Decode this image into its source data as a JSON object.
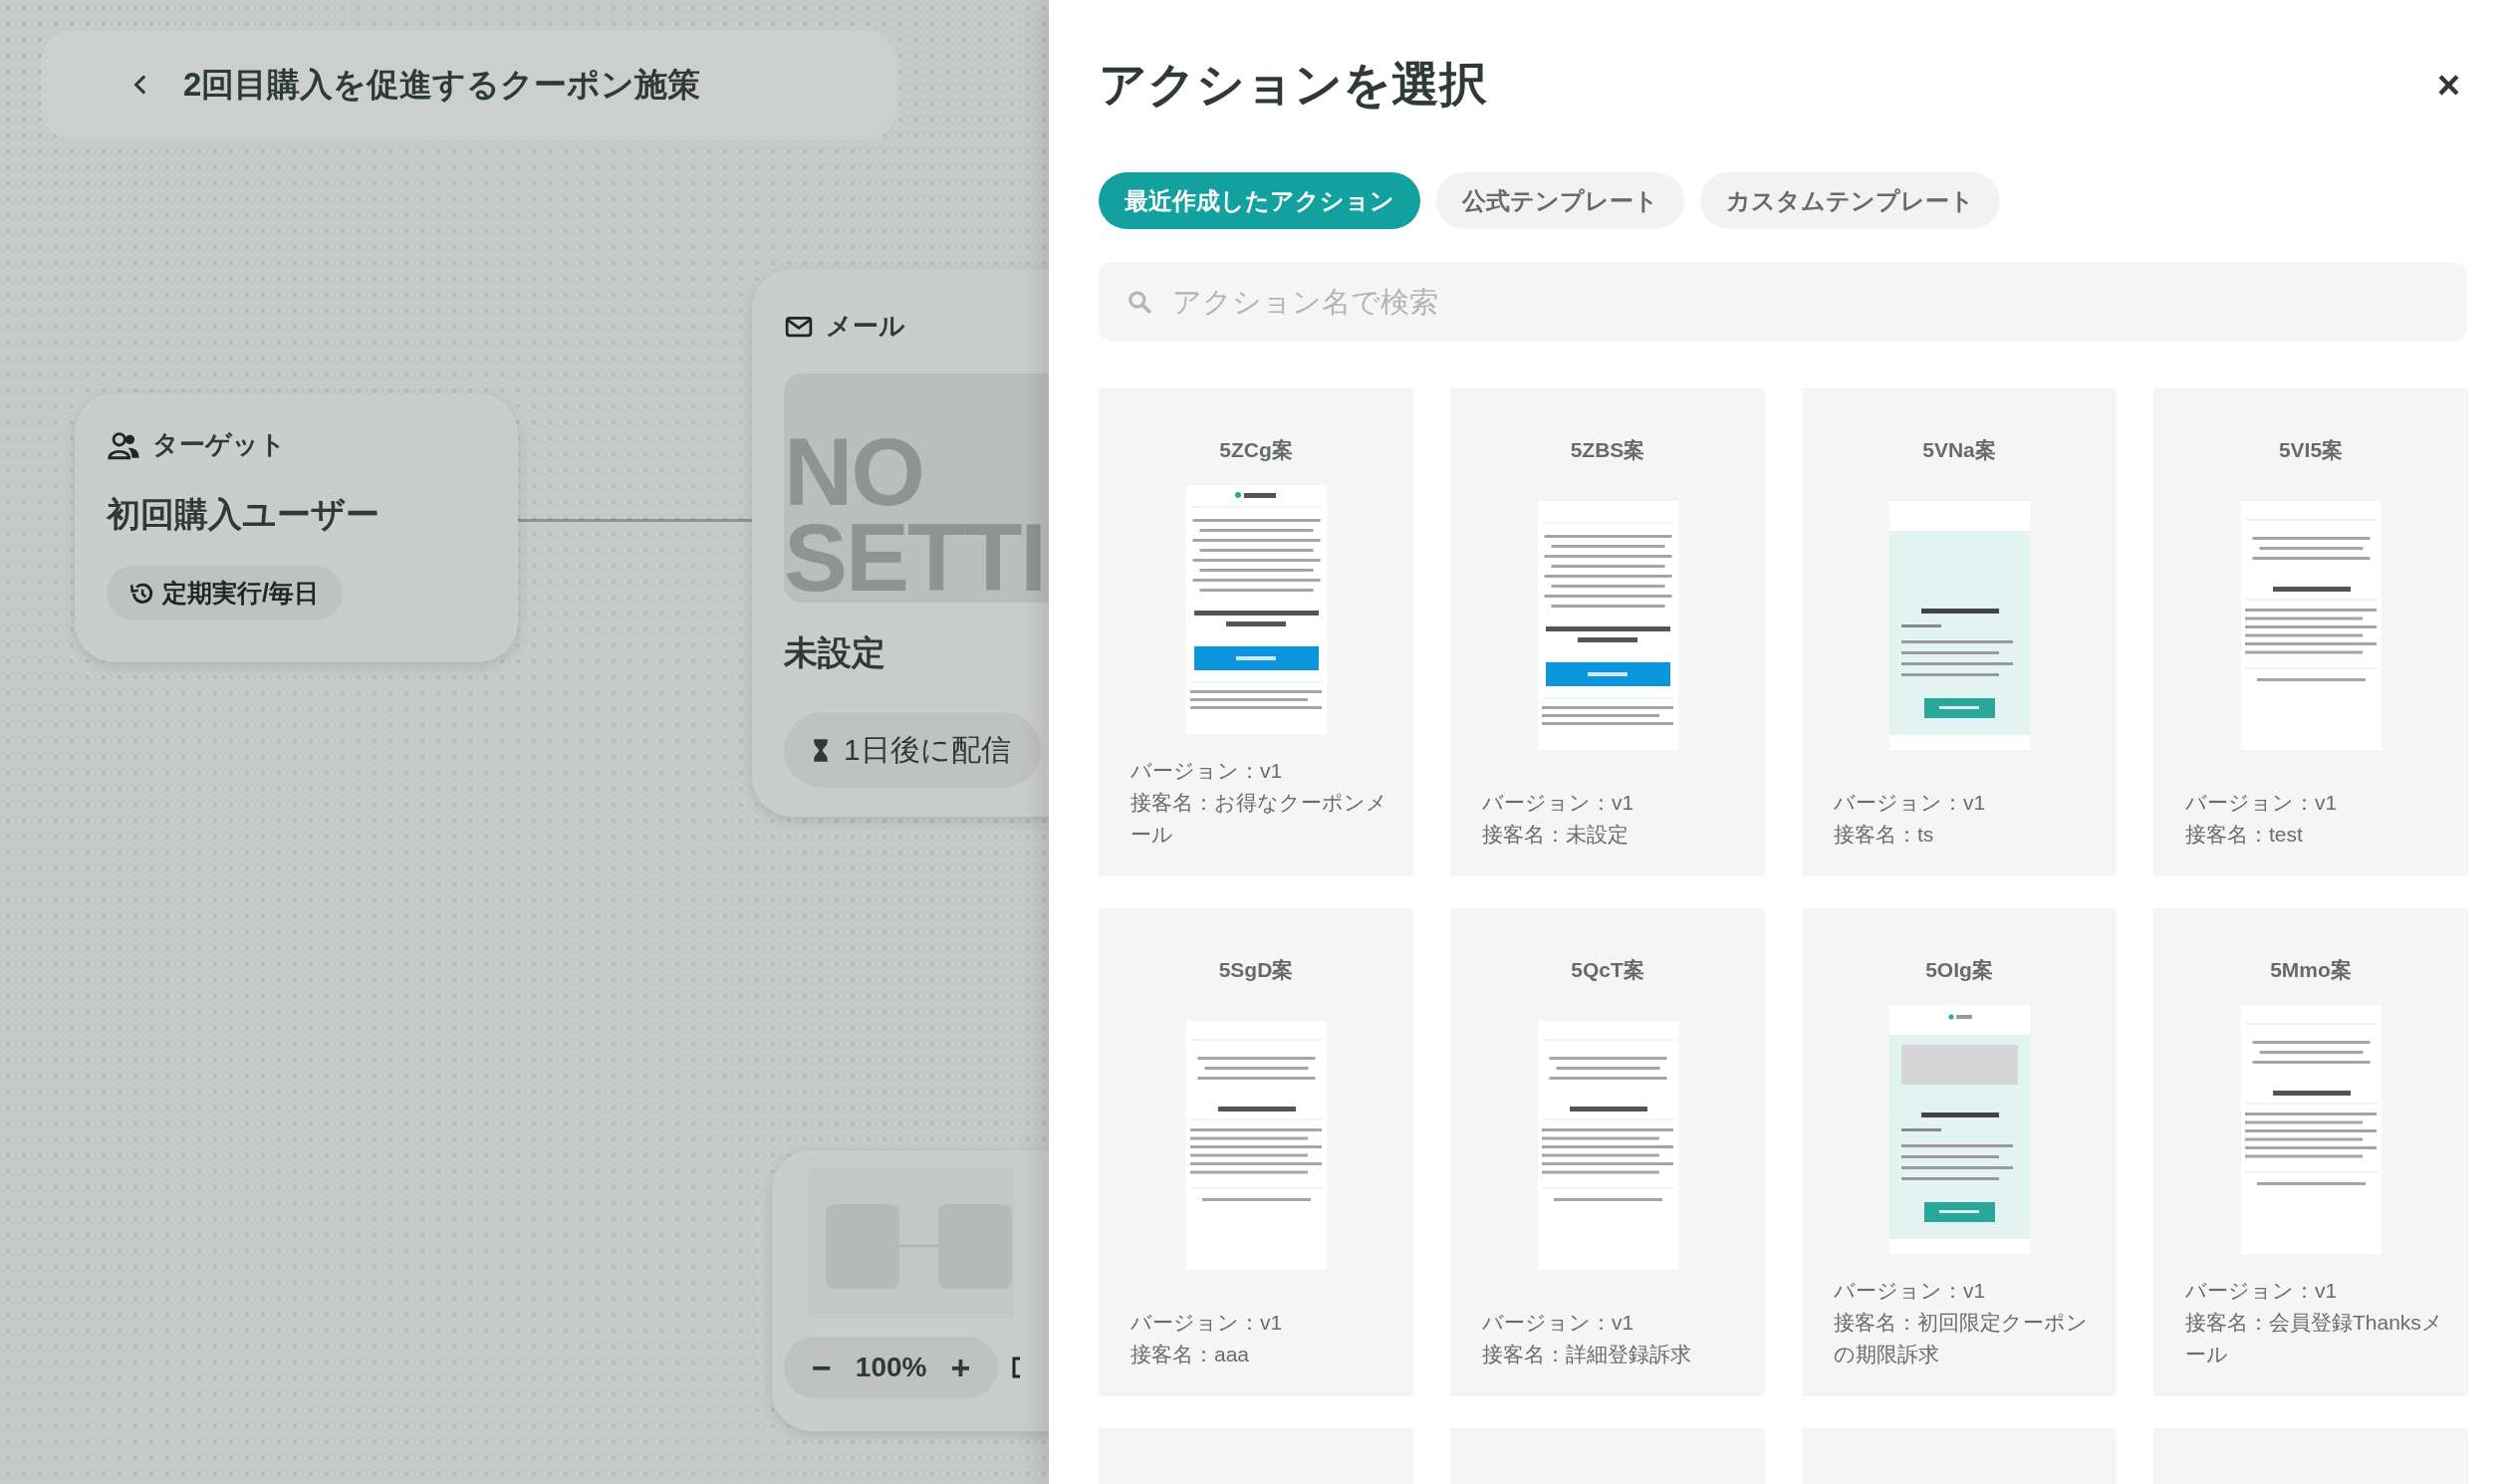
{
  "canvas": {
    "header": {
      "title": "2回目購入を促進するクーポン施策"
    },
    "target_node": {
      "label": "ターゲット",
      "name": "初回購入ユーザー",
      "schedule": "定期実行/毎日"
    },
    "mail_node": {
      "label": "メール",
      "placeholder_lines": [
        "NO",
        "SETTI"
      ],
      "name": "未設定",
      "delay": "1日後に配信"
    },
    "zoom": {
      "minus": "−",
      "level": "100%",
      "plus": "+"
    }
  },
  "panel": {
    "title": "アクションを選択",
    "close": "×",
    "tabs": [
      {
        "label": "最近作成したアクション",
        "selected": true
      },
      {
        "label": "公式テンプレート",
        "selected": false
      },
      {
        "label": "カスタムテンプレート",
        "selected": false
      }
    ],
    "search": {
      "placeholder": "アクション名で検索"
    },
    "cards": [
      {
        "kind": "full",
        "title": "5ZCg案",
        "preview": {
          "kind": "cart",
          "logo": true
        },
        "version": "バージョン：v1",
        "name": "接客名：お得なクーポンメール"
      },
      {
        "kind": "full",
        "title": "5ZBS案",
        "preview": {
          "kind": "cart",
          "logo": false
        },
        "version": "バージョン：v1",
        "name": "接客名：未設定"
      },
      {
        "kind": "full",
        "title": "5VNa案",
        "preview": {
          "kind": "teal",
          "logo": false
        },
        "version": "バージョン：v1",
        "name": "接客名：ts"
      },
      {
        "kind": "full",
        "title": "5VI5案",
        "preview": {
          "kind": "recent",
          "logo": false
        },
        "version": "バージョン：v1",
        "name": "接客名：test"
      },
      {
        "kind": "full",
        "title": "5SgD案",
        "preview": {
          "kind": "recent",
          "logo": false
        },
        "version": "バージョン：v1",
        "name": "接客名：aaa"
      },
      {
        "kind": "full",
        "title": "5QcT案",
        "preview": {
          "kind": "recent",
          "logo": false
        },
        "version": "バージョン：v1",
        "name": "接客名：詳細登録訴求"
      },
      {
        "kind": "full",
        "title": "5OIg案",
        "preview": {
          "kind": "teal",
          "logo": true
        },
        "version": "バージョン：v1",
        "name": "接客名：初回限定クーポンの期限訴求"
      },
      {
        "kind": "full",
        "title": "5Mmo案",
        "preview": {
          "kind": "recent",
          "logo": false
        },
        "version": "バージョン：v1",
        "name": "接客名：会員登録Thanksメール"
      },
      {
        "kind": "cut-off"
      },
      {
        "kind": "cut-off"
      },
      {
        "kind": "cut-off"
      },
      {
        "kind": "cut-off"
      }
    ]
  }
}
